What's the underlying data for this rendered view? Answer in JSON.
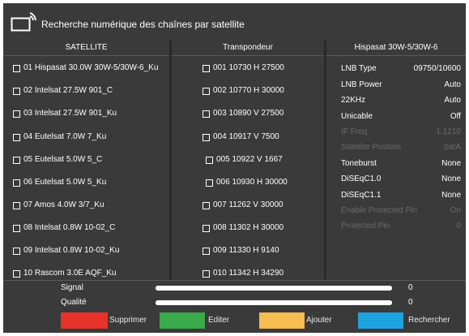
{
  "header": {
    "title": "Recherche numérique des chaînes par satellite"
  },
  "satellites": {
    "heading": "SATELLITE",
    "items": [
      "01  Hispasat 30.0W 30W-5/30W-6_Ku",
      "02 Intelsat 27.5W 901_C",
      "03 Intelsat 27.5W 901_Ku",
      "04  Eutelsat 7.0W 7_Ku",
      "05  Eutelsat 5.0W 5_C",
      "06  Eutelsat 5.0W 5_Ku",
      "07  Amos 4.0W 3/7_Ku",
      "08  Intelsat 0.8W 10-02_C",
      "09  Intelsat 0.8W 10-02_Ku",
      "10  Rascom 3.0E AQF_Ku"
    ]
  },
  "transponders": {
    "heading": "Transpondeur",
    "items": [
      "001 10730 H 27500",
      "002 10770 H 30000",
      "003 10890 V 27500",
      "004 10917 V  7500",
      "005 10922 V 1667",
      "006 10930 H 30000",
      "007 11262 V 30000",
      "008 11302 H 30000",
      "009 11330 H 9140",
      "010 11342 H 34290"
    ]
  },
  "info": {
    "heading": "Hispasat 30W-5/30W-6",
    "rows": [
      {
        "label": "LNB Type",
        "value": "09750/10600",
        "enabled": true
      },
      {
        "label": "LNB Power",
        "value": "Auto",
        "enabled": true
      },
      {
        "label": "22KHz",
        "value": "Auto",
        "enabled": true
      },
      {
        "label": "Unicable",
        "value": "Off",
        "enabled": true
      },
      {
        "label": "IF Freq",
        "value": "1.1210",
        "enabled": false
      },
      {
        "label": "Satellite Position",
        "value": "SatA",
        "enabled": false
      },
      {
        "label": "Toneburst",
        "value": "None",
        "enabled": true
      },
      {
        "label": "DiSEqC1.0",
        "value": "None",
        "enabled": true
      },
      {
        "label": "DiSEqC1.1",
        "value": "None",
        "enabled": true
      },
      {
        "label": "Enable Protected Pin",
        "value": "On",
        "enabled": false
      },
      {
        "label": "Protected Pin",
        "value": "0",
        "enabled": false
      }
    ]
  },
  "signal": {
    "signal_label": "Signal",
    "signal_value": "0",
    "quality_label": "Qualité",
    "quality_value": "0"
  },
  "legend": [
    {
      "color": "#e8322b",
      "label": "Supprimer",
      "icon": "red-key"
    },
    {
      "color": "#3aaa4a",
      "label": "Editer",
      "icon": "green-key"
    },
    {
      "color": "#f6bd4f",
      "label": "Ajouter",
      "icon": "yellow-key"
    },
    {
      "color": "#1fa3e0",
      "label": "Rechercher",
      "icon": "blue-key"
    }
  ]
}
